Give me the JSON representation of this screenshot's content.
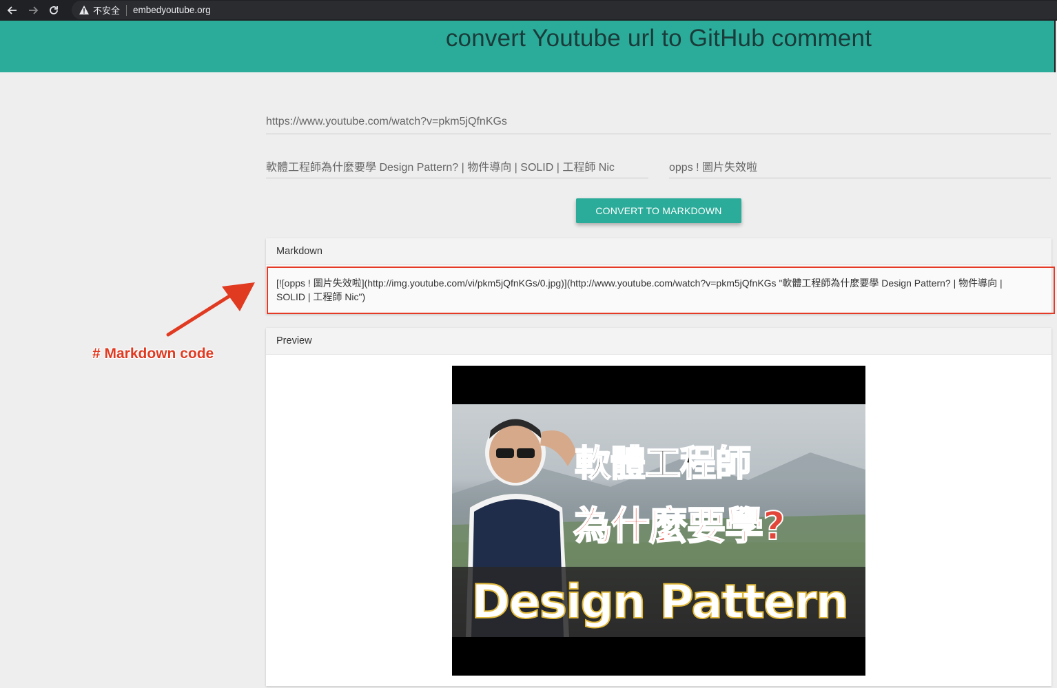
{
  "browser": {
    "security_label": "不安全",
    "url": "embedyoutube.org"
  },
  "header": {
    "title": "convert Youtube url to GitHub comment",
    "color": "#2bab99"
  },
  "form": {
    "youtube_url": "https://www.youtube.com/watch?v=pkm5jQfnKGs",
    "video_title": "軟體工程師為什麼要學 Design Pattern? | 物件導向 | SOLID | 工程師 Nic",
    "alt_text": "opps ! 圖片失效啦",
    "convert_label": "CONVERT TO MARKDOWN"
  },
  "markdown": {
    "heading": "Markdown",
    "code": "[![opps ! 圖片失效啦](http://img.youtube.com/vi/pkm5jQfnKGs/0.jpg)](http://www.youtube.com/watch?v=pkm5jQfnKGs \"軟體工程師為什麼要學 Design Pattern? | 物件導向 | SOLID | 工程師 Nic\")"
  },
  "preview": {
    "heading": "Preview",
    "thumb_line1": "軟體工程師",
    "thumb_line2": "為什麼要學?",
    "thumb_line3": "Design Pattern"
  },
  "annotation": {
    "label": "# Markdown code",
    "color": "#e03a21"
  }
}
